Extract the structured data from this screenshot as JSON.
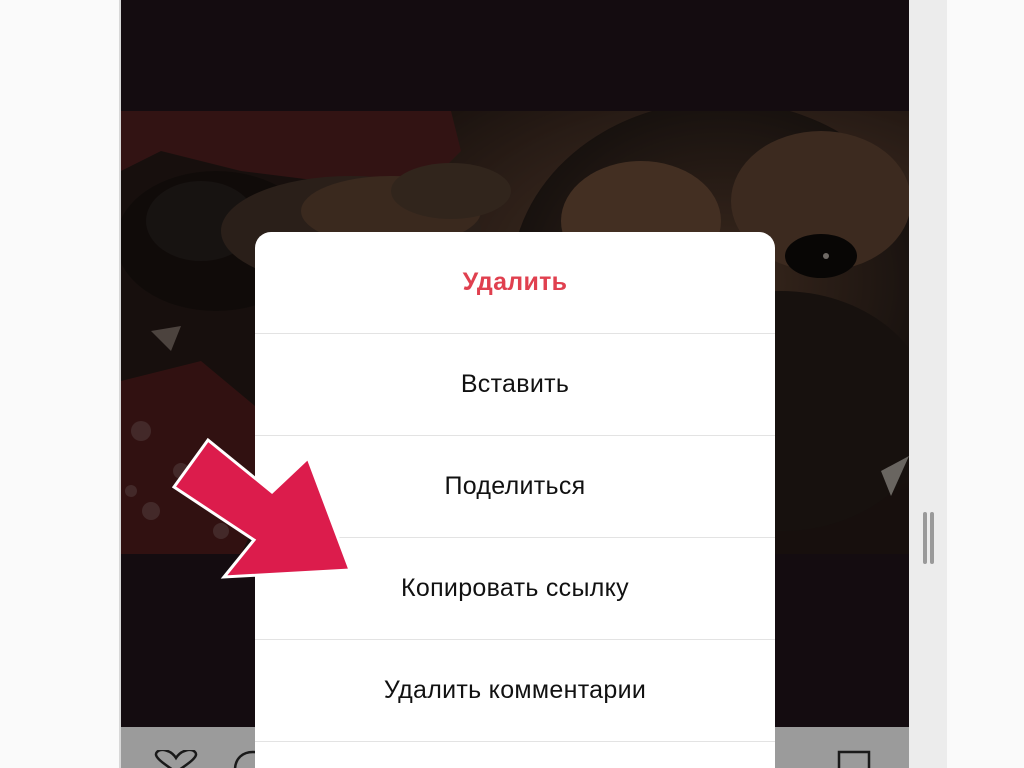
{
  "menu": {
    "items": [
      {
        "label": "Удалить",
        "style": "danger"
      },
      {
        "label": "Вставить",
        "style": "normal"
      },
      {
        "label": "Поделиться",
        "style": "normal"
      },
      {
        "label": "Копировать ссылку",
        "style": "normal"
      },
      {
        "label": "Удалить комментарии",
        "style": "normal"
      }
    ]
  },
  "colors": {
    "danger": "#e0404f",
    "arrow": "#dc1c4c",
    "frame_background": "#140c10",
    "toolbar": "#9b9b9b"
  },
  "icons": {
    "toolbar_left": "heart-icon",
    "toolbar_second": "comment-icon",
    "toolbar_right": "bookmark-icon",
    "annotation": "red-arrow-icon"
  }
}
